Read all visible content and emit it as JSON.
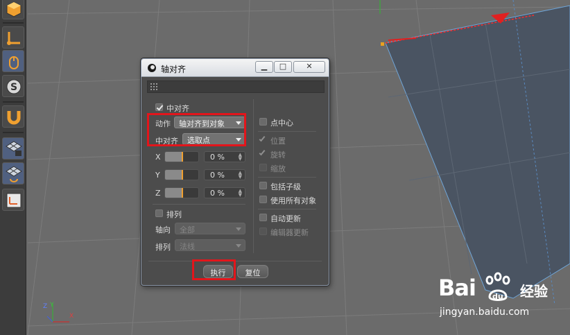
{
  "dialog": {
    "title": "轴对齐",
    "min_glyph": "▁",
    "max_glyph": "□",
    "close_glyph": "✕",
    "center_align_label": "中对齐",
    "center_align_checked": true,
    "action_label": "动作",
    "action_value": "轴对齐到对象",
    "center_mode_label": "中对齐",
    "center_mode_value": "选取点",
    "axes": [
      {
        "label": "X",
        "value": "0 %"
      },
      {
        "label": "Y",
        "value": "0 %"
      },
      {
        "label": "Z",
        "value": "0 %"
      }
    ],
    "arrange_label": "排列",
    "arrange_checked": false,
    "axis_dir_label": "轴向",
    "axis_dir_value": "全部",
    "arrange_mode_label": "排列",
    "arrange_mode_value": "法线",
    "right_options": {
      "point_center": {
        "label": "点中心",
        "checked": false
      },
      "position": {
        "label": "位置",
        "checked": true,
        "disabled": true
      },
      "rotation": {
        "label": "旋转",
        "checked": true,
        "disabled": true
      },
      "scale": {
        "label": "缩放",
        "checked": false,
        "disabled": true
      },
      "include_children": {
        "label": "包括子级",
        "checked": false
      },
      "use_all_objects": {
        "label": "使用所有对象",
        "checked": false
      },
      "auto_update": {
        "label": "自动更新",
        "checked": false
      },
      "editor_update": {
        "label": "编辑器更新",
        "checked": false,
        "disabled": true
      }
    },
    "execute_label": "执行",
    "reset_label": "复位"
  },
  "gizmo": {
    "z": "Z",
    "y": "Y",
    "x": "X"
  },
  "watermark": {
    "logo_text": "Bai",
    "logo_text2": "du",
    "cn_text": "经验",
    "url": "jingyan.baidu.com"
  },
  "colors": {
    "highlight_box": "#e3151b",
    "viewport_bg": "#6a6a6a",
    "plane": "#4a5462",
    "axis_red": "#e02020"
  },
  "toolbar_icons": [
    "cube-icon",
    "axis-l-icon",
    "mouse-icon",
    "s-sphere-icon",
    "magnet-icon",
    "grid-lock-icon",
    "grid-rotate-icon",
    "workplane-icon"
  ]
}
